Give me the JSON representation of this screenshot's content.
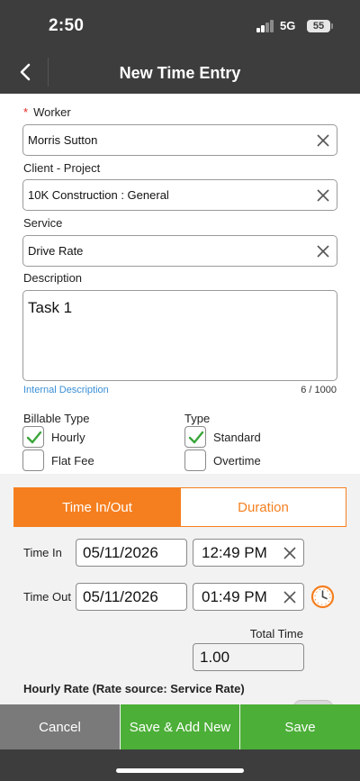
{
  "status_bar": {
    "time": "2:50",
    "network": "5G",
    "battery": "55"
  },
  "header": {
    "title": "New Time Entry"
  },
  "form": {
    "worker": {
      "label": "Worker",
      "required_mark": "*",
      "value": "Morris Sutton"
    },
    "client_project": {
      "label": "Client - Project",
      "value": "10K Construction : General"
    },
    "service": {
      "label": "Service",
      "value": "Drive Rate"
    },
    "description": {
      "label": "Description",
      "value": "Task 1",
      "internal_link": "Internal Description",
      "counter": "6 / 1000"
    },
    "billable_type": {
      "label": "Billable Type",
      "options": [
        {
          "label": "Hourly",
          "checked": true
        },
        {
          "label": "Flat Fee",
          "checked": false
        }
      ]
    },
    "type": {
      "label": "Type",
      "options": [
        {
          "label": "Standard",
          "checked": true
        },
        {
          "label": "Overtime",
          "checked": false
        }
      ]
    }
  },
  "mode_tabs": {
    "active": "Time In/Out",
    "inactive": "Duration"
  },
  "time": {
    "time_in": {
      "label": "Time In",
      "date": "05/11/2026",
      "time": "12:49 PM"
    },
    "time_out": {
      "label": "Time Out",
      "date": "05/11/2026",
      "time": "01:49 PM"
    },
    "total": {
      "label": "Total Time",
      "value": "1.00"
    }
  },
  "hourly_rate": {
    "label": "Hourly Rate (Rate source:  Service Rate)"
  },
  "actions": {
    "cancel": "Cancel",
    "save_add_new": "Save & Add New",
    "save": "Save"
  },
  "colors": {
    "header": "#3d3d3d",
    "accent_orange": "#f57f1f",
    "save_green": "#4caf38",
    "cancel_gray": "#7a7a7a",
    "link_blue": "#3a8fd6",
    "check_green": "#3aa63a"
  }
}
